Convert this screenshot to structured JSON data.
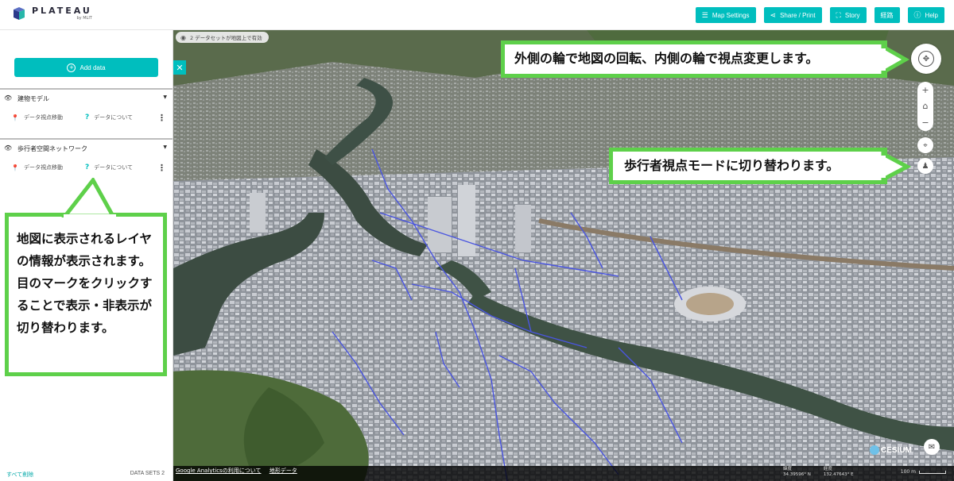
{
  "app": {
    "logo_title": "PLATEAU",
    "logo_sub": "by MLIT"
  },
  "topbar": {
    "buttons": [
      {
        "label": "Map Settings",
        "icon": "sliders-icon"
      },
      {
        "label": "Share / Print",
        "icon": "share-icon"
      },
      {
        "label": "Story",
        "icon": "story-icon"
      },
      {
        "label": "経路",
        "icon": ""
      },
      {
        "label": "Help",
        "icon": "help-icon"
      }
    ]
  },
  "sidebar": {
    "add_data_label": "Add data",
    "layers": [
      {
        "name": "建物モデル",
        "action_move": "データ視点移動",
        "action_about": "データについて"
      },
      {
        "name": "歩行者空間ネットワーク",
        "action_move": "データ視点移動",
        "action_about": "データについて"
      }
    ],
    "clear_all_label": "すべて削除",
    "dataset_count_label": "DATA SETS 2"
  },
  "map": {
    "dataset_pill": "2 データセットが地図上で有効",
    "footer_links": [
      "Google Analyticsの利用について",
      "地形データ"
    ],
    "lat_label": "緯度",
    "lat_value": "34.39596° N",
    "lon_label": "経度",
    "lon_value": "132.47643° E",
    "scale_label": "100 m",
    "cesium_label": "CESIUM"
  },
  "callouts": {
    "left": "地図に表示されるレイヤの情報が表示されます。目のマークをクリックすることで表示・非表示が切り替わります。",
    "rotation": "外側の輪で地図の回転、内側の輪で視点変更します。",
    "pedestrian": "歩行者視点モードに切り替わります。"
  },
  "colors": {
    "accent": "#00bebe",
    "callout_border": "#5ed04a",
    "network_line": "#4a55e0"
  }
}
